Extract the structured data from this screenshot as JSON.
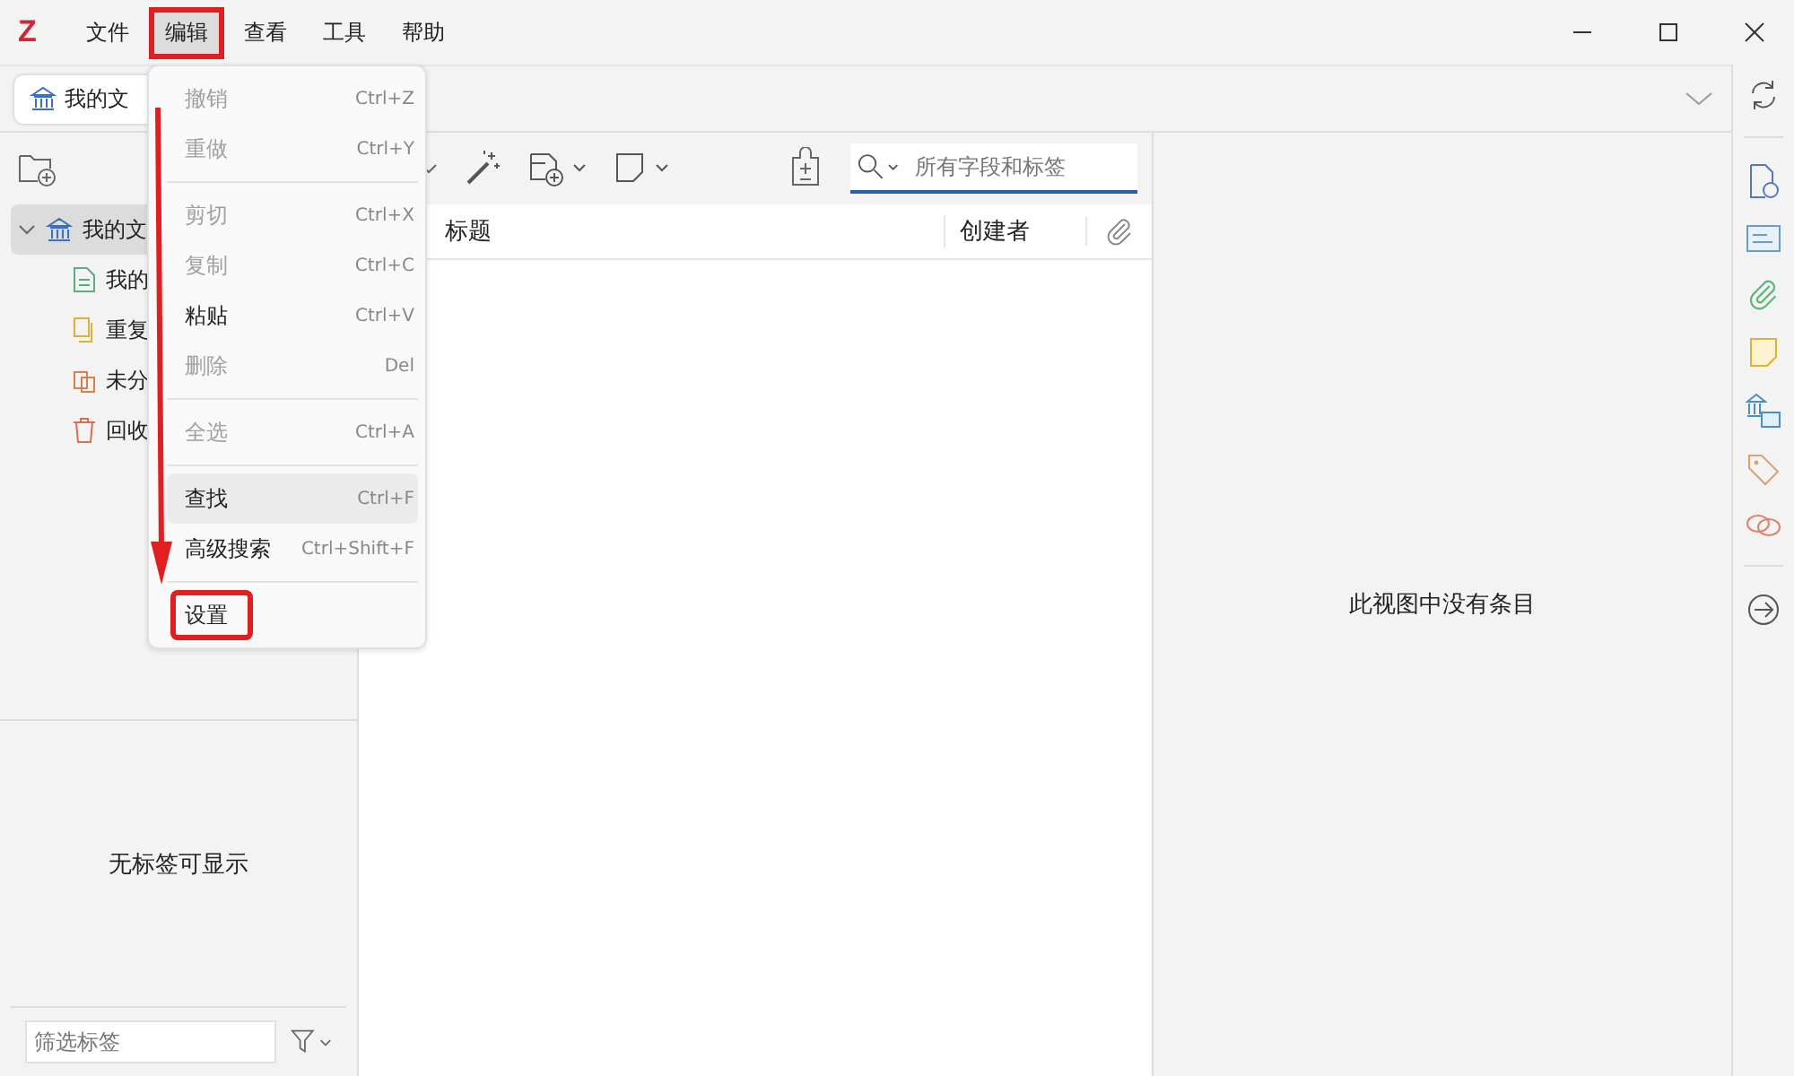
{
  "window": {
    "logo": "Z",
    "menu_bar": [
      {
        "label": "文件",
        "selected": false,
        "annotated": false
      },
      {
        "label": "编辑",
        "selected": true,
        "annotated": true
      },
      {
        "label": "查看",
        "selected": false,
        "annotated": false
      },
      {
        "label": "工具",
        "selected": false,
        "annotated": false
      },
      {
        "label": "帮助",
        "selected": false,
        "annotated": false
      }
    ]
  },
  "library_tab": {
    "label": "我的文"
  },
  "collections": [
    {
      "label": "我的文",
      "kind": "library",
      "selected": true,
      "expanded": true,
      "children": [
        {
          "label": "我的",
          "kind": "publications",
          "selected": false
        },
        {
          "label": "重复",
          "kind": "duplicates",
          "selected": false
        },
        {
          "label": "未分",
          "kind": "unfiled",
          "selected": false
        },
        {
          "label": "回收",
          "kind": "trash",
          "selected": false
        }
      ]
    }
  ],
  "tag_pane": {
    "empty_message": "无标签可显示",
    "filter": {
      "placeholder": "筛选标签"
    }
  },
  "search": {
    "placeholder": "所有字段和标签"
  },
  "columns": [
    "标题",
    "创建者"
  ],
  "empty_message": "此视图中没有条目",
  "edit_menu": [
    [
      {
        "label": "撤销",
        "shortcut": "Ctrl+Z",
        "disabled": true,
        "highlighted": false,
        "annotated": false
      },
      {
        "label": "重做",
        "shortcut": "Ctrl+Y",
        "disabled": true,
        "highlighted": false,
        "annotated": false
      }
    ],
    [
      {
        "label": "剪切",
        "shortcut": "Ctrl+X",
        "disabled": true,
        "highlighted": false,
        "annotated": false
      },
      {
        "label": "复制",
        "shortcut": "Ctrl+C",
        "disabled": true,
        "highlighted": false,
        "annotated": false
      },
      {
        "label": "粘贴",
        "shortcut": "Ctrl+V",
        "disabled": false,
        "highlighted": false,
        "annotated": false
      },
      {
        "label": "删除",
        "shortcut": "Del",
        "disabled": true,
        "highlighted": false,
        "annotated": false
      }
    ],
    [
      {
        "label": "全选",
        "shortcut": "Ctrl+A",
        "disabled": true,
        "highlighted": false,
        "annotated": false
      }
    ],
    [
      {
        "label": "查找",
        "shortcut": "Ctrl+F",
        "disabled": false,
        "highlighted": true,
        "annotated": false
      },
      {
        "label": "高级搜索",
        "shortcut": "Ctrl+Shift+F",
        "disabled": false,
        "highlighted": false,
        "annotated": false
      }
    ],
    [
      {
        "label": "设置",
        "disabled": false,
        "highlighted": false,
        "annotated": true
      }
    ]
  ],
  "annotation_arrow": true
}
